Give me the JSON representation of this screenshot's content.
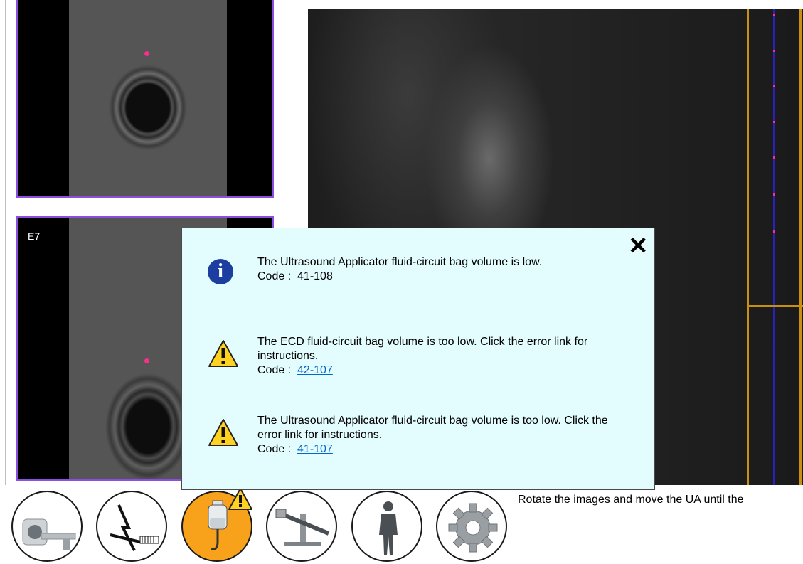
{
  "thumbnails": [
    {
      "label": ""
    },
    {
      "label": "E7"
    }
  ],
  "alerts": [
    {
      "type": "info",
      "icon": "info-icon",
      "message": "The Ultrasound Applicator fluid-circuit bag volume is low.",
      "code_label": "Code :",
      "code": "41-108",
      "code_is_link": false
    },
    {
      "type": "warning",
      "icon": "warning-icon",
      "message": "The ECD fluid-circuit bag volume is too low. Click the error link for instructions.",
      "code_label": "Code :",
      "code": "42-107",
      "code_is_link": true
    },
    {
      "type": "warning",
      "icon": "warning-icon",
      "message": "The Ultrasound Applicator fluid-circuit bag volume is too low. Click the error link for instructions.",
      "code_label": "Code :",
      "code": "41-107",
      "code_is_link": true
    }
  ],
  "alert_panel": {
    "close_icon": "close-icon",
    "close_glyph": "✕"
  },
  "toolbar": {
    "buttons": [
      {
        "name": "mri-scanner",
        "icon": "mri-scanner-icon",
        "active": false
      },
      {
        "name": "applicator-calibration",
        "icon": "applicator-icon",
        "active": false
      },
      {
        "name": "fluid-bag",
        "icon": "fluid-bag-icon",
        "active": true,
        "warning": true
      },
      {
        "name": "positioning-system",
        "icon": "positioning-icon",
        "active": false
      },
      {
        "name": "patient",
        "icon": "patient-icon",
        "active": false
      },
      {
        "name": "settings",
        "icon": "gear-icon",
        "active": false
      }
    ],
    "status_text": "Rotate the images and move the UA until the"
  },
  "colors": {
    "thumbnail_border": "#8b4fe0",
    "target_dot": "#ff2d8a",
    "ruler_gold": "#c8900e",
    "ruler_blue": "#2a1fbf",
    "alert_bg": "#e3fcfd",
    "active_button": "#f7a21a",
    "link": "#0066cc"
  }
}
